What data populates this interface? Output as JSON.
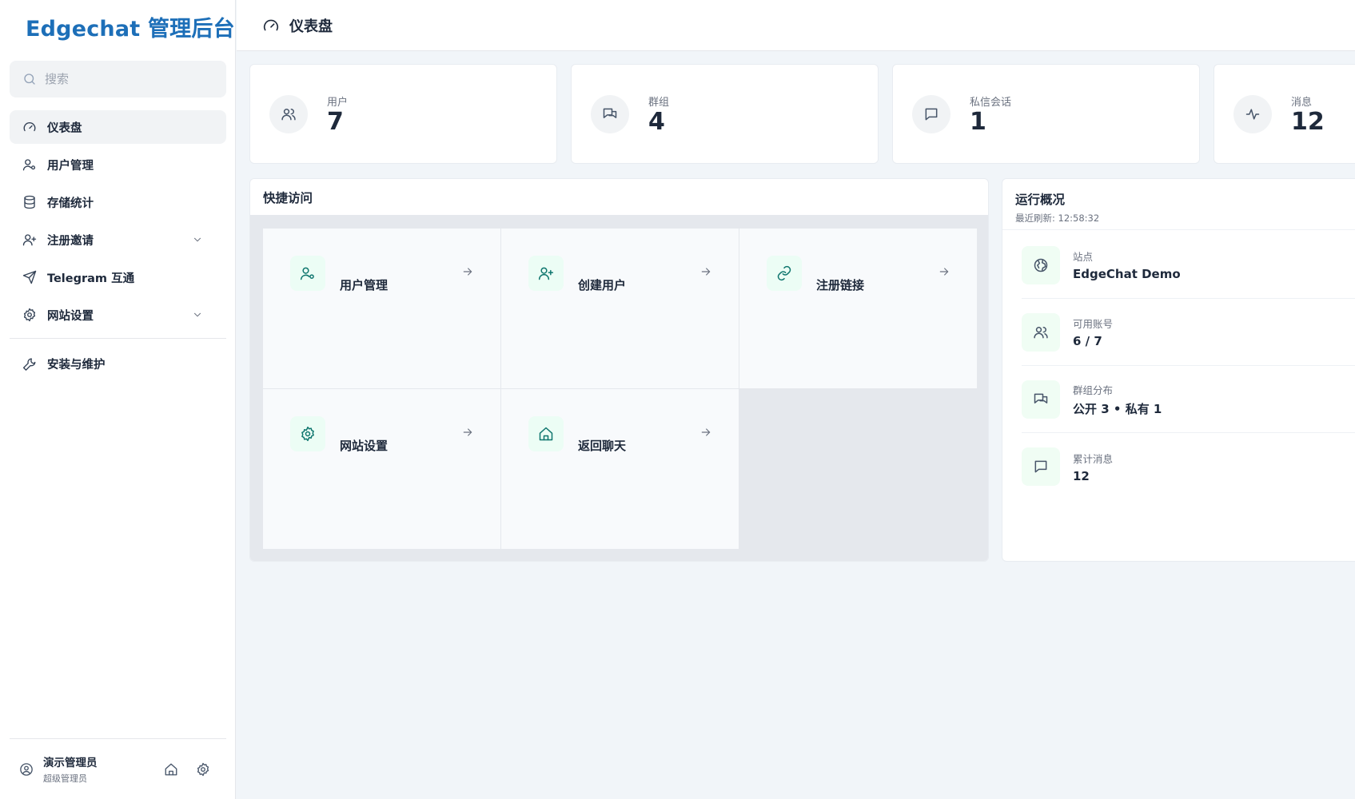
{
  "brand": "Edgechat 管理后台",
  "search": {
    "placeholder": "搜索"
  },
  "nav": {
    "items": [
      {
        "label": "仪表盘",
        "icon": "gauge-icon",
        "active": true
      },
      {
        "label": "用户管理",
        "icon": "user-cog-icon"
      },
      {
        "label": "存储统计",
        "icon": "database-icon"
      },
      {
        "label": "注册邀请",
        "icon": "user-plus-icon",
        "expandable": true
      },
      {
        "label": "Telegram 互通",
        "icon": "send-icon"
      },
      {
        "label": "网站设置",
        "icon": "gear-icon",
        "expandable": true
      },
      {
        "label": "安装与维护",
        "icon": "wrench-icon"
      }
    ]
  },
  "user": {
    "name": "演示管理员",
    "role": "超级管理员"
  },
  "topbar": {
    "title": "仪表盘",
    "icon": "gauge-icon"
  },
  "stats": [
    {
      "label": "用户",
      "value": "7",
      "icon": "users-icon"
    },
    {
      "label": "群组",
      "value": "4",
      "icon": "chats-icon"
    },
    {
      "label": "私信会话",
      "value": "1",
      "icon": "message-icon"
    },
    {
      "label": "消息",
      "value": "12",
      "icon": "activity-icon"
    }
  ],
  "quick": {
    "title": "快捷访问",
    "tiles": [
      {
        "label": "用户管理",
        "icon": "user-cog-icon"
      },
      {
        "label": "创建用户",
        "icon": "user-plus-icon"
      },
      {
        "label": "注册链接",
        "icon": "link-icon"
      },
      {
        "label": "网站设置",
        "icon": "gear-icon"
      },
      {
        "label": "返回聊天",
        "icon": "home-icon"
      }
    ]
  },
  "overview": {
    "title": "运行概况",
    "refreshed": "最近刷新: 12:58:32",
    "rows": [
      {
        "label": "站点",
        "value": "EdgeChat Demo",
        "icon": "globe-icon"
      },
      {
        "label": "可用账号",
        "value": "6 / 7",
        "icon": "users-icon"
      },
      {
        "label": "群组分布",
        "value": "公开 3 • 私有 1",
        "icon": "chats-icon"
      },
      {
        "label": "累计消息",
        "value": "12",
        "icon": "message-icon"
      }
    ]
  },
  "colors": {
    "brand": "#1d6fb8",
    "accent": "#0f766e",
    "bg": "#f1f5f9"
  }
}
